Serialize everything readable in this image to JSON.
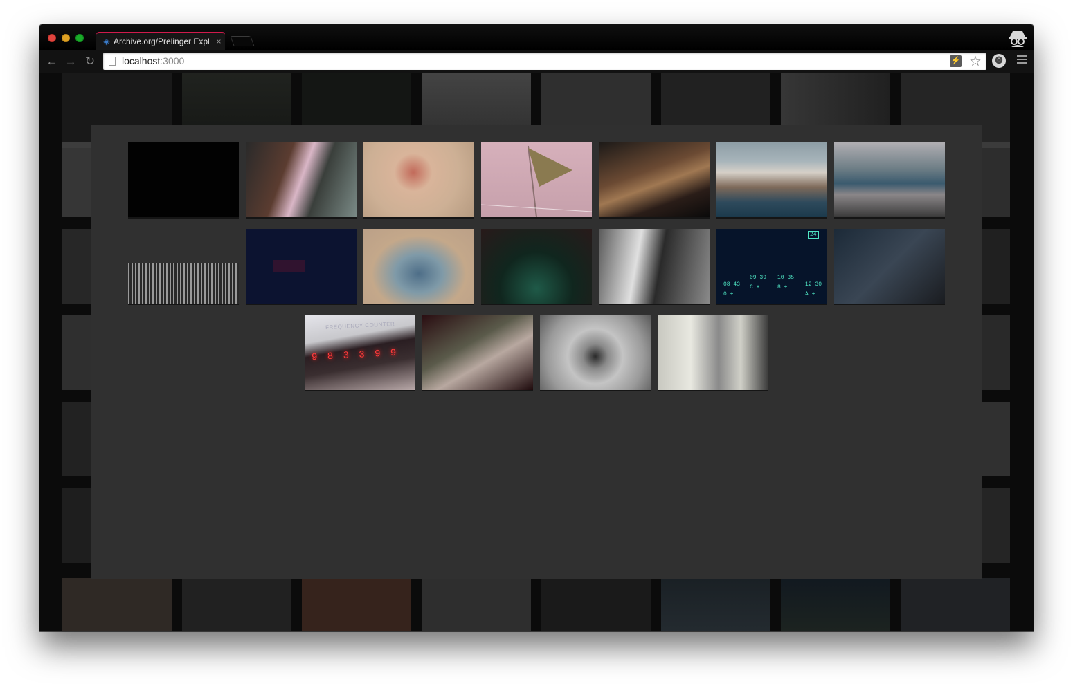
{
  "browser": {
    "tab": {
      "title": "Archive.org/Prelinger Expl",
      "close_glyph": "×",
      "favicon": "◈"
    },
    "nav": {
      "back": "←",
      "forward": "→",
      "reload": "↻"
    },
    "address": {
      "host": "localhost",
      "port": ":3000"
    },
    "omnibox_icons": {
      "extension": "⚡",
      "bookmark": "☆"
    },
    "extension_icon": "⓿"
  },
  "gallery": {
    "thumbnails": [
      {
        "caption": ""
      },
      {
        "caption": ""
      },
      {
        "caption": ""
      },
      {
        "caption": ""
      },
      {
        "caption": ""
      },
      {
        "caption": ""
      },
      {
        "caption": ""
      },
      {
        "caption": ""
      },
      {
        "caption": ""
      },
      {
        "caption": ""
      },
      {
        "caption": ""
      },
      {
        "caption": ""
      },
      {
        "caption": ""
      },
      {
        "caption": ""
      },
      {
        "caption": "FREQUENCY COUNTER"
      },
      {
        "caption": ""
      },
      {
        "caption": ""
      },
      {
        "caption": ""
      }
    ],
    "frequency_digits": "9 8 3 3 9 9",
    "hud": {
      "corner": "24",
      "r1": "08 43",
      "r2": "0  +",
      "r3": "09 39",
      "r4": "C  +",
      "r5": "10 35",
      "r6": "8  +",
      "r7": "12 30",
      "r8": "A  +"
    }
  },
  "colors": {
    "accent_tab": "#d01a4c",
    "overlay": "#303030",
    "page_bg": "#0b0b0b"
  }
}
